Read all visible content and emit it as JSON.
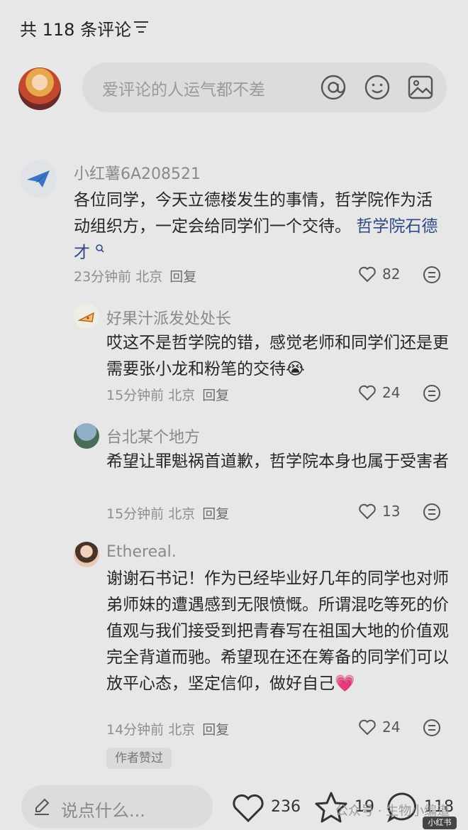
{
  "header": {
    "title": "共 118 条评论",
    "filter_icon": "filter-icon"
  },
  "composer": {
    "placeholder": "爱评论的人运气都不差",
    "icons": [
      "at-icon",
      "emoji-icon",
      "image-icon"
    ]
  },
  "comments": [
    {
      "name": "小红薯6A208521",
      "text": "各位同学，今天立德楼发生的事情，哲学院作为活动组织方，一定会给同学们一个交待。",
      "topic": "哲学院石德才",
      "time": "23分钟前 北京",
      "reply": "回复",
      "likes": "82"
    },
    {
      "name": "好果汁派发处处长",
      "text": "哎这不是哲学院的错，感觉老师和同学们还是更需要张小龙和粉笔的交待",
      "emoji": "😭",
      "time": "15分钟前 北京",
      "reply": "回复",
      "likes": "24"
    },
    {
      "name": "台北某个地方",
      "text": "希望让罪魁祸首道歉，哲学院本身也属于受害者",
      "time": "15分钟前 北京",
      "reply": "回复",
      "likes": "13"
    },
    {
      "name": "Ethereal.",
      "text": "谢谢石书记！作为已经毕业好几年的同学也对师弟师妹的遭遇感到无限愤慨。所谓混吃等死的价值观与我们接受到把青春写在祖国大地的价值观完全背道而驰。希望现在还在筹备的同学们可以放平心态，坚定信仰，做好自己",
      "emoji": "💗",
      "time": "14分钟前 北京",
      "reply": "回复",
      "likes": "24",
      "badge": "作者赞过"
    }
  ],
  "bottom_bar": {
    "placeholder": "说点什么...",
    "likes": "236",
    "stars": "19",
    "comments": "118"
  },
  "watermark": {
    "text": "公众号 · 生物小编道",
    "badge": "小红书"
  },
  "colors": {
    "background": "#e7e7e7",
    "topic_link": "#2c4a86",
    "heart_emoji": "#e24a8a"
  }
}
